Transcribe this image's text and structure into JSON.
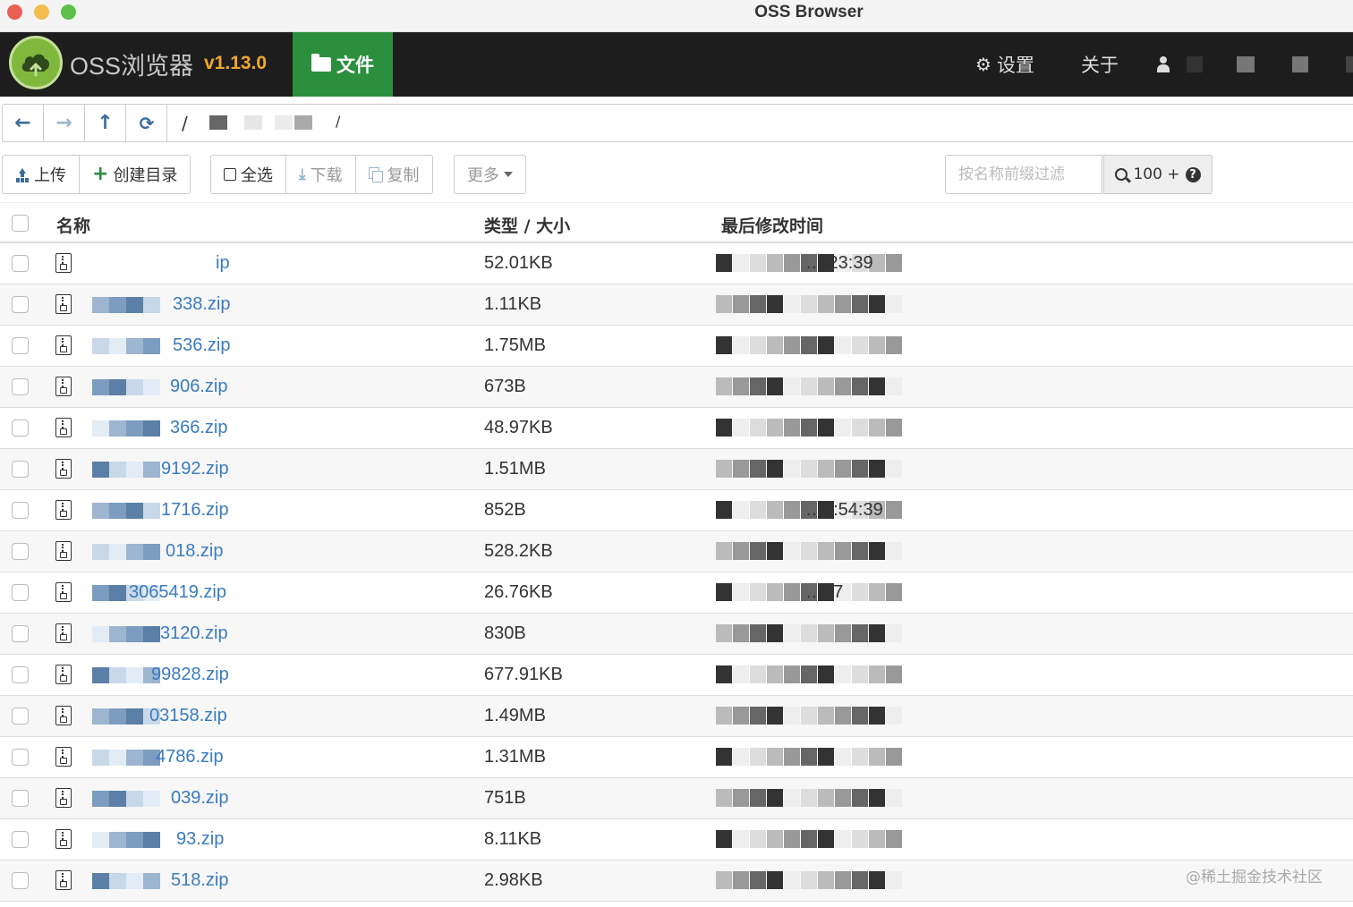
{
  "window": {
    "title": "OSS Browser"
  },
  "header": {
    "app_name": "OSS浏览器",
    "version": "v1.13.0",
    "files_tab": "文件",
    "settings": "设置",
    "about": "关于"
  },
  "toolbar": {
    "upload": "上传",
    "create_dir": "创建目录",
    "select_all": "全选",
    "download": "下载",
    "copy": "复制",
    "more": "更多",
    "filter_placeholder": "按名称前缀过滤",
    "search_count": "100 +"
  },
  "address": {
    "separator": "/"
  },
  "table": {
    "columns": {
      "name": "名称",
      "type_size": "类型 / 大小",
      "modified": "最后修改时间"
    },
    "rows": [
      {
        "name": "ip",
        "size": "52.01KB",
        "time": "…:23:39"
      },
      {
        "name": "338.zip",
        "size": "1.11KB",
        "time": ""
      },
      {
        "name": "536.zip",
        "size": "1.75MB",
        "time": ""
      },
      {
        "name": "906.zip",
        "size": "673B",
        "time": ""
      },
      {
        "name": "366.zip",
        "size": "48.97KB",
        "time": ""
      },
      {
        "name": "9192.zip",
        "size": "1.51MB",
        "time": ""
      },
      {
        "name": "1716.zip",
        "size": "852B",
        "time": "…1:54:39"
      },
      {
        "name": "018.zip",
        "size": "528.2KB",
        "time": ""
      },
      {
        "name": "3065419.zip",
        "size": "26.76KB",
        "time": "…37"
      },
      {
        "name": "3120.zip",
        "size": "830B",
        "time": ""
      },
      {
        "name": "99828.zip",
        "size": "677.91KB",
        "time": ""
      },
      {
        "name": "03158.zip",
        "size": "1.49MB",
        "time": ""
      },
      {
        "name": "4786.zip",
        "size": "1.31MB",
        "time": ""
      },
      {
        "name": "039.zip",
        "size": "751B",
        "time": ""
      },
      {
        "name": "93.zip",
        "size": "8.11KB",
        "time": ""
      },
      {
        "name": "518.zip",
        "size": "2.98KB",
        "time": ""
      }
    ]
  },
  "watermark": "@稀土掘金技术社区",
  "colors": {
    "header_bg": "#1d1d1d",
    "accent_green": "#2b8f3e",
    "version_orange": "#f0a830",
    "link_blue": "#3a7bbf"
  }
}
